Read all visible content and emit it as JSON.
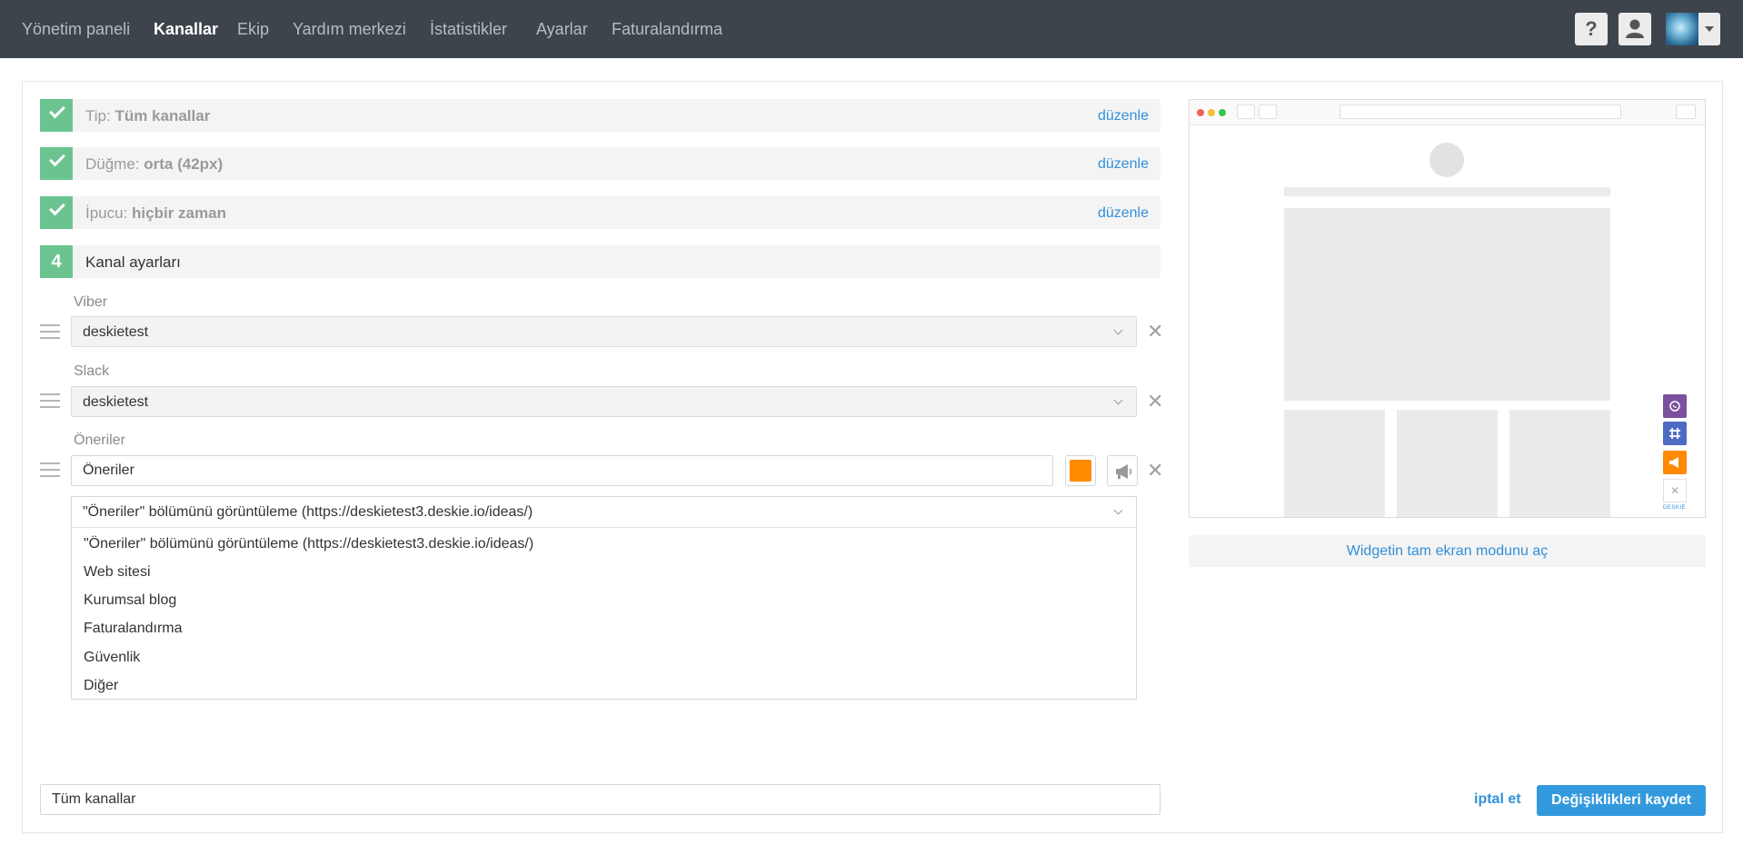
{
  "nav": {
    "items": [
      {
        "label": "Yönetim paneli",
        "active": false
      },
      {
        "label": "Kanallar",
        "active": true
      },
      {
        "label": "Ekip",
        "active": false
      },
      {
        "label": "Yardım merkezi",
        "active": false
      },
      {
        "label": "İstatistikler",
        "active": false
      },
      {
        "label": "Ayarlar",
        "active": false
      },
      {
        "label": "Faturalandırma",
        "active": false
      }
    ],
    "help_label": "?"
  },
  "steps": {
    "type": {
      "prefix": "Tip:",
      "value": "Tüm kanallar",
      "edit": "düzenle"
    },
    "button": {
      "prefix": "Düğme:",
      "value": "orta (42px)",
      "edit": "düzenle"
    },
    "hint": {
      "prefix": "İpucu:",
      "value": "hiçbir zaman",
      "edit": "düzenle"
    },
    "channel_settings": {
      "number": "4",
      "label": "Kanal ayarları"
    }
  },
  "channels": {
    "viber": {
      "label": "Viber",
      "value": "deskietest"
    },
    "slack": {
      "label": "Slack",
      "value": "deskietest"
    },
    "ideas": {
      "label": "Öneriler",
      "name_value": "Öneriler",
      "color": "#ff8a00",
      "selected": "\"Öneriler\" bölümünü görüntüleme (https://deskietest3.deskie.io/ideas/)",
      "options": [
        "\"Öneriler\" bölümünü görüntüleme (https://deskietest3.deskie.io/ideas/)",
        "Web sitesi",
        "Kurumsal blog",
        "Faturalandırma",
        "Güvenlik",
        "Diğer"
      ]
    }
  },
  "remove_symbol": "✕",
  "footer": {
    "name_value": "Tüm kanallar",
    "cancel": "iptal et",
    "save": "Değişiklikleri kaydet"
  },
  "preview": {
    "fullscreen": "Widgetin tam ekran modunu aç",
    "brand": "DESKIE",
    "close_symbol": "✕",
    "icon_colors": {
      "viber": "#7b519d",
      "slack": "#4e6bc4",
      "ideas": "#ff8a00"
    }
  },
  "colors": {
    "nav_bg": "#3e444c",
    "accent": "#3190d8",
    "success": "#6bc48f",
    "save_button": "#3399dd"
  }
}
